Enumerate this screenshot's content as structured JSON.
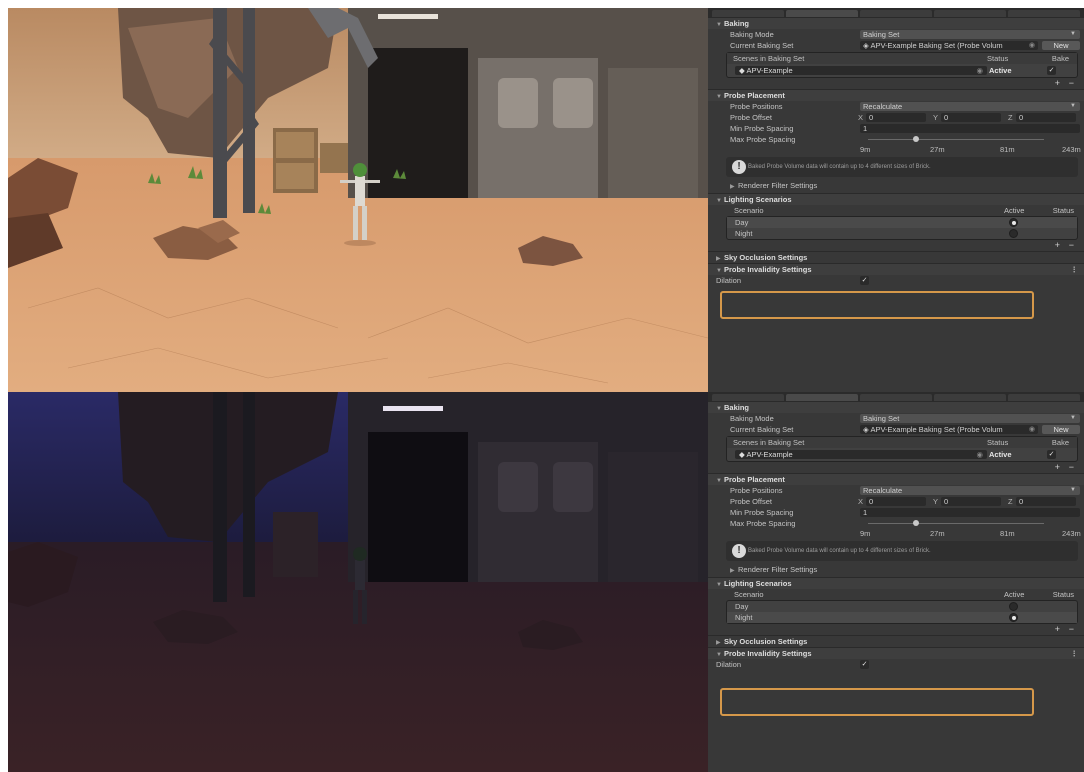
{
  "panels": [
    {
      "id": "day",
      "baking": {
        "section_title": "Baking",
        "baking_mode_label": "Baking Mode",
        "baking_mode_value": "Baking Set",
        "current_set_label": "Current Baking Set",
        "current_set_value": "APV-Example Baking Set (Probe Volum",
        "new_button": "New",
        "scenes_header": "Scenes in Baking Set",
        "status_header": "Status",
        "bake_header": "Bake",
        "scene_name": "APV-Example",
        "scene_status": "Active"
      },
      "probe_placement": {
        "section_title": "Probe Placement",
        "positions_label": "Probe Positions",
        "positions_value": "Recalculate",
        "offset_label": "Probe Offset",
        "offset_x": "0",
        "offset_y": "0",
        "offset_z": "0",
        "min_spacing_label": "Min Probe Spacing",
        "min_spacing_value": "1",
        "max_spacing_label": "Max Probe Spacing",
        "ticks": [
          "9m",
          "27m",
          "81m",
          "243m"
        ],
        "max_spacing_level": 0.27,
        "help_text": "Baked Probe Volume data will contain up to 4 different sizes of Brick."
      },
      "renderer_filter": "Renderer Filter Settings",
      "lighting": {
        "section_title": "Lighting Scenarios",
        "scenario_header": "Scenario",
        "active_header": "Active",
        "status_header": "Status",
        "scenarios": [
          "Day",
          "Night"
        ],
        "active_index": 0
      },
      "sky_occlusion": "Sky Occlusion Settings",
      "probe_invalidity": "Probe Invalidity Settings",
      "dilation_label": "Dilation"
    },
    {
      "id": "night",
      "baking": {
        "section_title": "Baking",
        "baking_mode_label": "Baking Mode",
        "baking_mode_value": "Baking Set",
        "current_set_label": "Current Baking Set",
        "current_set_value": "APV-Example Baking Set (Probe Volum",
        "new_button": "New",
        "scenes_header": "Scenes in Baking Set",
        "status_header": "Status",
        "bake_header": "Bake",
        "scene_name": "APV-Example",
        "scene_status": "Active"
      },
      "probe_placement": {
        "section_title": "Probe Placement",
        "positions_label": "Probe Positions",
        "positions_value": "Recalculate",
        "offset_label": "Probe Offset",
        "offset_x": "0",
        "offset_y": "0",
        "offset_z": "0",
        "min_spacing_label": "Min Probe Spacing",
        "min_spacing_value": "1",
        "max_spacing_label": "Max Probe Spacing",
        "ticks": [
          "9m",
          "27m",
          "81m",
          "243m"
        ],
        "max_spacing_level": 0.27,
        "help_text": "Baked Probe Volume data will contain up to 4 different sizes of Brick."
      },
      "renderer_filter": "Renderer Filter Settings",
      "lighting": {
        "section_title": "Lighting Scenarios",
        "scenario_header": "Scenario",
        "active_header": "Active",
        "status_header": "Status",
        "scenarios": [
          "Day",
          "Night"
        ],
        "active_index": 1
      },
      "sky_occlusion": "Sky Occlusion Settings",
      "probe_invalidity": "Probe Invalidity Settings",
      "dilation_label": "Dilation"
    }
  ],
  "colors": {
    "highlight": "#d5984a",
    "inspector_bg": "#383838",
    "day_sky": "#c9a57e",
    "night_sky": "#1e1d3a"
  }
}
